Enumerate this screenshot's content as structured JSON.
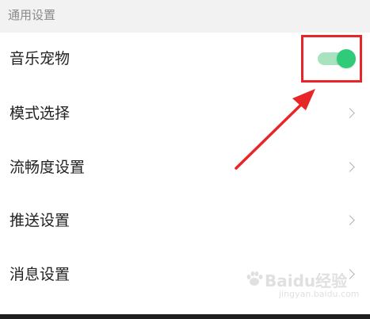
{
  "section": {
    "title": "通用设置"
  },
  "settings": [
    {
      "label": "音乐宠物",
      "type": "toggle",
      "enabled": true
    },
    {
      "label": "模式选择",
      "type": "chevron"
    },
    {
      "label": "流畅度设置",
      "type": "chevron"
    },
    {
      "label": "推送设置",
      "type": "chevron"
    },
    {
      "label": "消息设置",
      "type": "chevron"
    }
  ],
  "colors": {
    "toggle_on_knob": "#2fcb78",
    "toggle_on_track": "#a7e3bf",
    "annotation_red": "#e8262a",
    "section_background": "#f2f2f2",
    "list_background": "#ffffff"
  },
  "icons": {
    "chevron": "chevron-right-icon",
    "annotation": "red-arrow"
  },
  "watermark": {
    "brand": "Baidu经验",
    "sub": "jingyan.baidu.com"
  }
}
